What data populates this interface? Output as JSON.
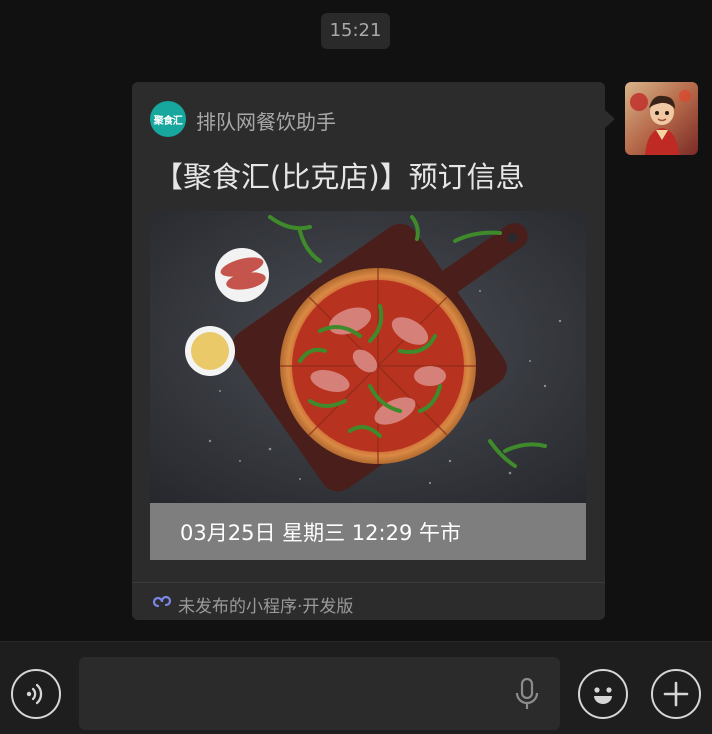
{
  "chat": {
    "timestamp": "15:21"
  },
  "card": {
    "app_logo_text": "聚食汇",
    "app_name": "排队网餐饮助手",
    "title": "【聚食汇(比克店)】预订信息",
    "reservation_info": "03月25日 星期三 12:29 午市",
    "footer": "未发布的小程序·开发版",
    "footer_icon": "mini-program-icon"
  },
  "input_bar": {
    "voice_icon": "voice-icon",
    "mic_icon": "microphone-icon",
    "emoji_icon": "emoji-icon",
    "plus_icon": "plus-icon",
    "message_value": ""
  },
  "colors": {
    "background": "#111111",
    "card": "#2c2c2c",
    "logo": "#17a79e",
    "info_bar": "#7e7e7e"
  }
}
